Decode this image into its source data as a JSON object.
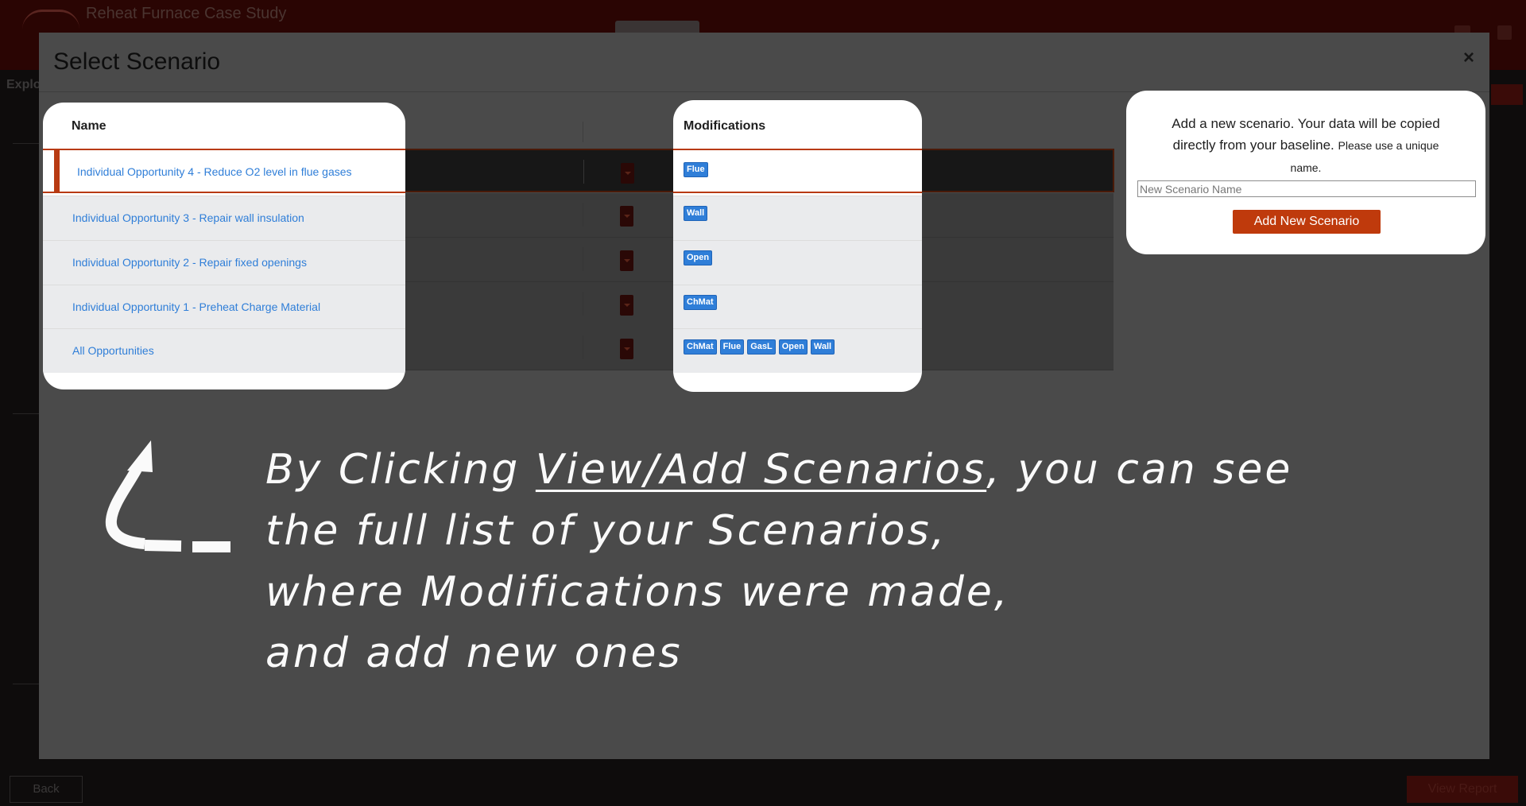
{
  "app": {
    "title": "Reheat Furnace Case Study",
    "section": "Explo",
    "back_label": "Back",
    "report_label": "View Report"
  },
  "modal": {
    "title": "Select Scenario",
    "close_label": "×"
  },
  "table": {
    "name_header": "Name",
    "mods_header": "Modifications",
    "rows": [
      {
        "name": "Individual Opportunity 4 - Reduce O2 level in flue gases",
        "mods": [
          "Flue"
        ],
        "selected": true
      },
      {
        "name": "Individual Opportunity 3 - Repair wall insulation",
        "mods": [
          "Wall"
        ]
      },
      {
        "name": "Individual Opportunity 2 - Repair fixed openings",
        "mods": [
          "Open"
        ]
      },
      {
        "name": "Individual Opportunity 1 - Preheat Charge Material",
        "mods": [
          "ChMat"
        ]
      },
      {
        "name": "All Opportunities",
        "mods": [
          "ChMat",
          "Flue",
          "GasL",
          "Open",
          "Wall"
        ]
      }
    ]
  },
  "add_scenario": {
    "text": "Add a new scenario. Your data will be copied directly from your baseline.",
    "note": "Please use a unique name.",
    "placeholder": "New Scenario Name",
    "button_label": "Add New Scenario"
  },
  "annotation": {
    "prefix": "By Clicking ",
    "link": "View/Add Scenarios",
    "suffix": ", you can see",
    "line2": "the full list of your Scenarios,",
    "line3": "where Modifications were made,",
    "line4": "and add new ones"
  },
  "colors": {
    "accent": "#bf3a0c",
    "link": "#2f7ed8",
    "badge": "#2f7ed8"
  }
}
